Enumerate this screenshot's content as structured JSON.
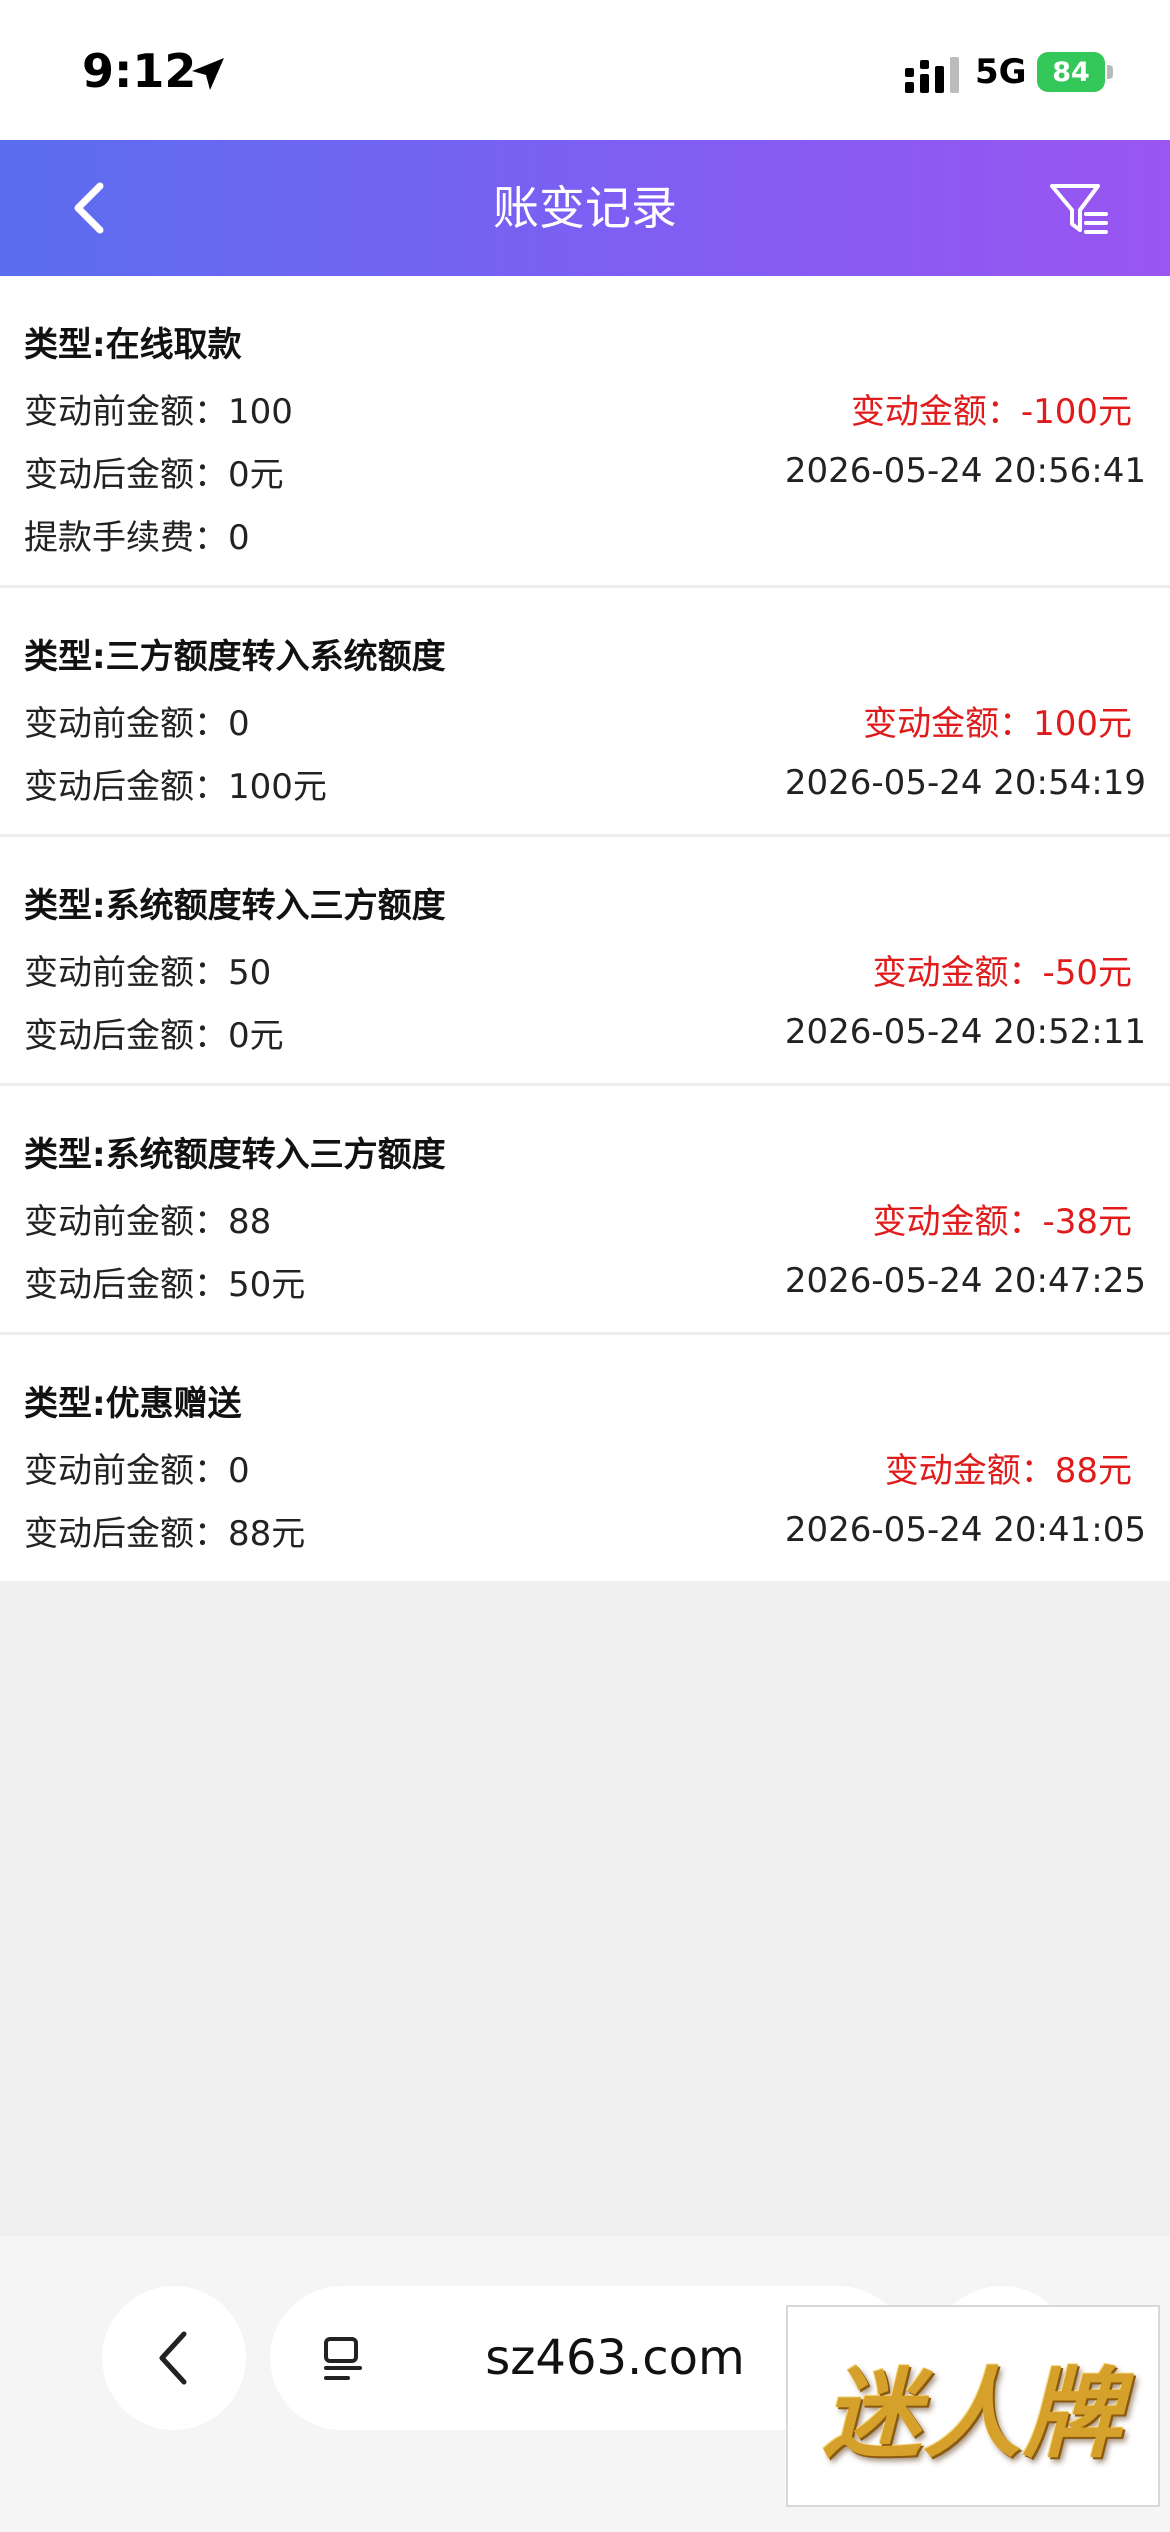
{
  "status_bar": {
    "time": "9:12",
    "network": "5G",
    "battery": "84"
  },
  "header": {
    "title": "账变记录"
  },
  "records": [
    {
      "type": "类型:在线取款",
      "before": "变动前金额：100",
      "change": "变动金额：-100元",
      "after": "变动后金额：0元",
      "time": "2026-05-24 20:56:41",
      "fee": "提款手续费：0"
    },
    {
      "type": "类型:三方额度转入系统额度",
      "before": "变动前金额：0",
      "change": "变动金额：100元",
      "after": "变动后金额：100元",
      "time": "2026-05-24 20:54:19"
    },
    {
      "type": "类型:系统额度转入三方额度",
      "before": "变动前金额：50",
      "change": "变动金额：-50元",
      "after": "变动后金额：0元",
      "time": "2026-05-24 20:52:11"
    },
    {
      "type": "类型:系统额度转入三方额度",
      "before": "变动前金额：88",
      "change": "变动金额：-38元",
      "after": "变动后金额：50元",
      "time": "2026-05-24 20:47:25"
    },
    {
      "type": "类型:优惠赠送",
      "before": "变动前金额：0",
      "change": "变动金额：88元",
      "after": "变动后金额：88元",
      "time": "2026-05-24 20:41:05"
    }
  ],
  "browser": {
    "url": "sz463.com"
  },
  "ad": {
    "text": "迷人牌"
  },
  "colors": {
    "header_gradient_start": "#5b6ef0",
    "header_gradient_end": "#9a55f2",
    "change_amount": "#e01b1b",
    "battery": "#34c759"
  }
}
